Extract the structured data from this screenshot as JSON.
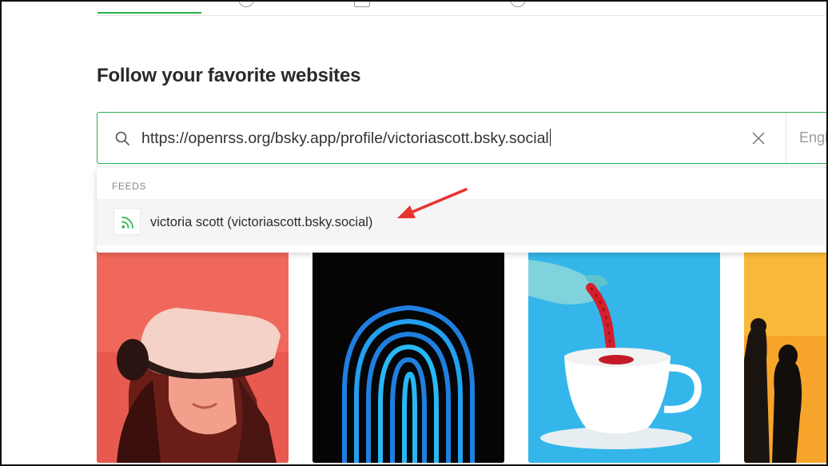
{
  "page": {
    "heading": "Follow your favorite websites"
  },
  "search": {
    "value": "https://openrss.org/bsky.app/profile/victoriascott.bsky.social",
    "language_label": "Engl"
  },
  "dropdown": {
    "section_header": "FEEDS",
    "results": [
      {
        "label": "victoria scott (victoriascott.bsky.social)",
        "icon": "rss-icon"
      }
    ]
  },
  "icons": {
    "search": "search-icon",
    "clear": "close-icon",
    "result": "rss-icon"
  },
  "colors": {
    "accent": "#2bb24c",
    "annotation_arrow": "#e8342e"
  },
  "cards": [
    {
      "image": "vr-headset-photo"
    },
    {
      "image": "fingerprint-photo"
    },
    {
      "image": "teapot-pouring-photo"
    },
    {
      "image": "silhouettes-photo"
    }
  ]
}
